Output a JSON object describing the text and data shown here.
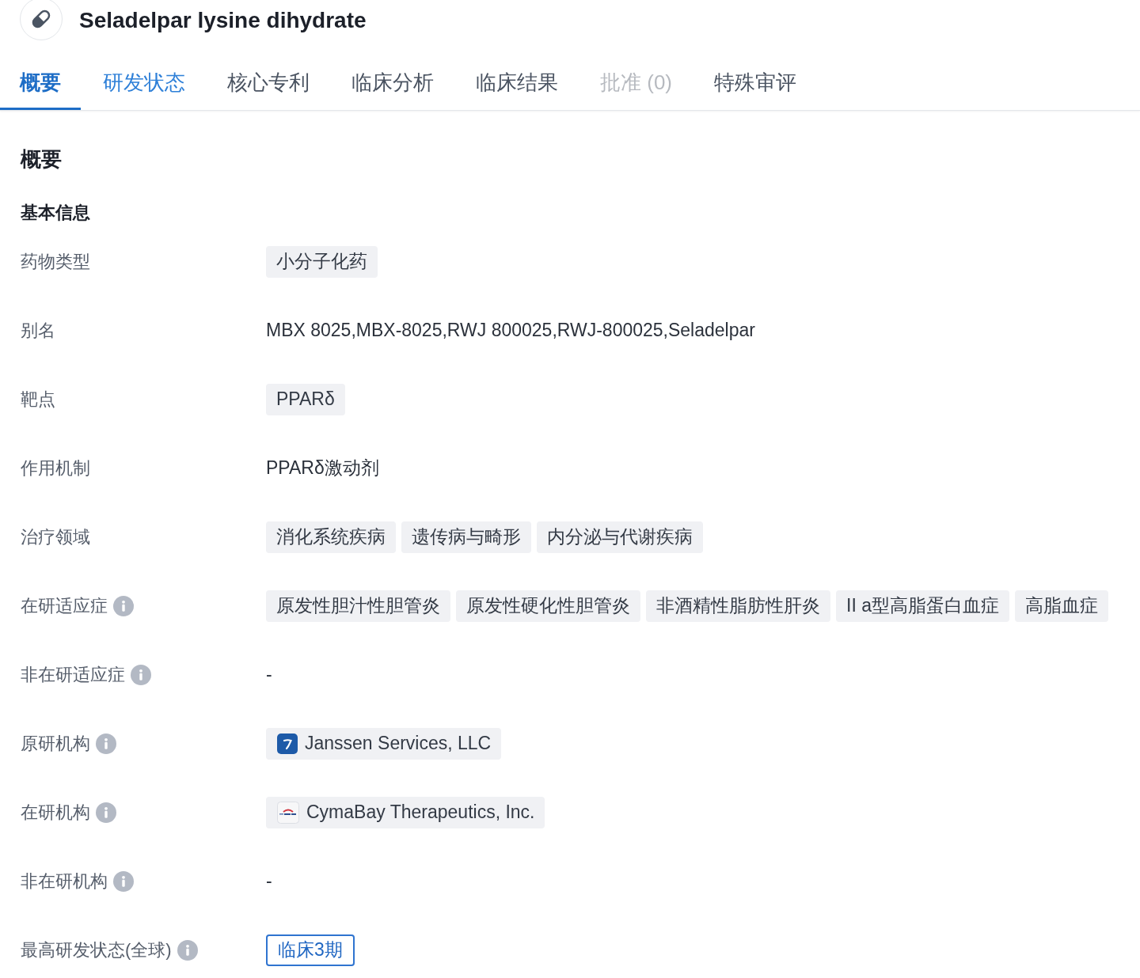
{
  "header": {
    "title": "Seladelpar lysine dihydrate"
  },
  "tabs": [
    {
      "label": "概要",
      "selected": true,
      "highlighted": false,
      "disabled": false
    },
    {
      "label": "研发状态",
      "selected": false,
      "highlighted": true,
      "disabled": false
    },
    {
      "label": "核心专利",
      "selected": false,
      "highlighted": false,
      "disabled": false
    },
    {
      "label": "临床分析",
      "selected": false,
      "highlighted": false,
      "disabled": false
    },
    {
      "label": "临床结果",
      "selected": false,
      "highlighted": false,
      "disabled": false
    },
    {
      "label": "批准 (0)",
      "selected": false,
      "highlighted": false,
      "disabled": true
    },
    {
      "label": "特殊审评",
      "selected": false,
      "highlighted": false,
      "disabled": false
    }
  ],
  "section": {
    "title": "概要",
    "subtitle": "基本信息"
  },
  "fields": [
    {
      "label": "药物类型",
      "info": false,
      "kind": "tags",
      "tags": [
        "小分子化药"
      ]
    },
    {
      "label": "别名",
      "info": false,
      "kind": "text",
      "value": "MBX 8025,MBX-8025,RWJ 800025,RWJ-800025,Seladelpar"
    },
    {
      "label": "靶点",
      "info": false,
      "kind": "tags",
      "tags": [
        "PPARδ"
      ]
    },
    {
      "label": "作用机制",
      "info": false,
      "kind": "text",
      "value": "PPARδ激动剂"
    },
    {
      "label": "治疗领域",
      "info": false,
      "kind": "tags",
      "tags": [
        "消化系统疾病",
        "遗传病与畸形",
        "内分泌与代谢疾病"
      ]
    },
    {
      "label": "在研适应症",
      "info": true,
      "kind": "tags",
      "tags": [
        "原发性胆汁性胆管炎",
        "原发性硬化性胆管炎",
        "非酒精性脂肪性肝炎",
        "II a型高脂蛋白血症",
        "高脂血症"
      ]
    },
    {
      "label": "非在研适应症",
      "info": true,
      "kind": "text",
      "value": "-"
    },
    {
      "label": "原研机构",
      "info": true,
      "kind": "orgs",
      "orgs": [
        {
          "name": "Janssen Services, LLC",
          "kind": "square"
        }
      ]
    },
    {
      "label": "在研机构",
      "info": true,
      "kind": "orgs",
      "orgs": [
        {
          "name": "CymaBay Therapeutics, Inc.",
          "kind": "wordmark"
        }
      ]
    },
    {
      "label": "非在研机构",
      "info": true,
      "kind": "text",
      "value": "-"
    },
    {
      "label": "最高研发状态(全球)",
      "info": true,
      "kind": "status",
      "value": "临床3期"
    }
  ]
}
